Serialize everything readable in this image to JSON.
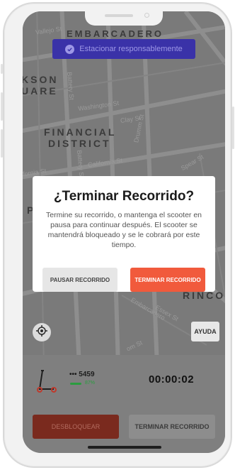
{
  "banner": {
    "text": "Estacionar responsablemente",
    "icon": "check-circle-icon"
  },
  "map": {
    "labels": {
      "embarcadero": "EMBARCADERO",
      "kson": "KSON",
      "uare": "UARE",
      "financial": "FINANCIAL",
      "district": "DISTRICT",
      "rincon": "RINCON"
    },
    "streets": {
      "s1": "Vallejo St",
      "s2": "Battery St",
      "s3": "Washington St",
      "s4": "Clay St",
      "s5": "Drumm St",
      "s6": "California St",
      "s7": "Battery St",
      "s8": "ifornia St",
      "s9": "Spear St",
      "s10": "Embarcadero",
      "s11": "Essex St",
      "s12": "om St",
      "s13": "P"
    }
  },
  "dialog": {
    "title": "¿Terminar Recorrido?",
    "message": "Termine su recorrido, o mantenga el scooter en pausa para continuar después. El scooter se mantendrá bloqueado y se le cobrará por este tiempo.",
    "pause_label": "PAUSAR RECORRIDO",
    "end_label": "TERMINAR RECORRIDO"
  },
  "help_label": "AYUDA",
  "trip": {
    "scooter_id": "••• 5459",
    "battery_percent": 87,
    "battery_text": "87%",
    "timer": "00:00:02"
  },
  "bottom": {
    "unlock_label": "DESBLOQUEAR",
    "end_label": "TERMINAR RECORRIDO"
  },
  "colors": {
    "accent": "#f15a3c",
    "banner": "#3a32a8",
    "battery": "#2a9d3f"
  }
}
